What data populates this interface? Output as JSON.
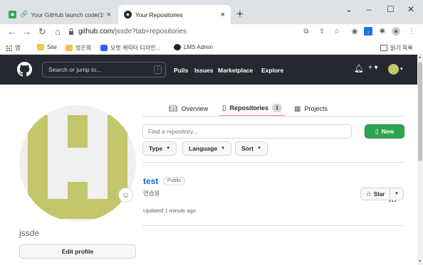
{
  "browser": {
    "tabs": [
      {
        "title": "Your GitHub launch code(15",
        "close": "×"
      },
      {
        "title": "Your Repositories",
        "close": "×"
      }
    ],
    "new_tab": "+",
    "window_controls": [
      "⌄",
      "–",
      "☐",
      "✕"
    ],
    "url_host": "github.com",
    "url_path": "/jssde?tab=repositories",
    "bookmarks": [
      {
        "label": "앱",
        "icon": "apps-grid-icon",
        "color": "#e8453c"
      },
      {
        "label": "Site",
        "icon": "folder-icon",
        "color": "#f6c343"
      },
      {
        "label": "정은희",
        "icon": "folder-icon",
        "color": "#f6c343"
      },
      {
        "label": "모핫 캐릭터 디자인...",
        "icon": "site-icon",
        "color": "#2962ff"
      },
      {
        "label": "LMS Admin",
        "icon": "globe-icon",
        "color": "#202124"
      }
    ],
    "reading_list": "읽기 목록"
  },
  "github": {
    "search_placeholder": "Search or jump to...",
    "search_key": "/",
    "nav": [
      "Pulls",
      "Issues",
      "Marketplace",
      "Explore"
    ],
    "notification_icon": "bell-icon",
    "plus_menu": "+ ▾",
    "avatar_caret": "▾"
  },
  "profile": {
    "username": "jssde",
    "edit_profile_label": "Edit profile",
    "avatar_color": "#c3c66a"
  },
  "tabs": {
    "overview": "Overview",
    "repositories": "Repositories",
    "repositories_count": "1",
    "projects": "Projects",
    "more": "···"
  },
  "repos": {
    "find_placeholder": "Find a repository...",
    "new_label": "New",
    "filters": [
      "Type",
      "Language",
      "Sort"
    ],
    "items": [
      {
        "name": "test",
        "visibility": "Public",
        "description": "연습용",
        "updated": "Updated 1 minute ago",
        "star_label": "Star"
      }
    ]
  }
}
